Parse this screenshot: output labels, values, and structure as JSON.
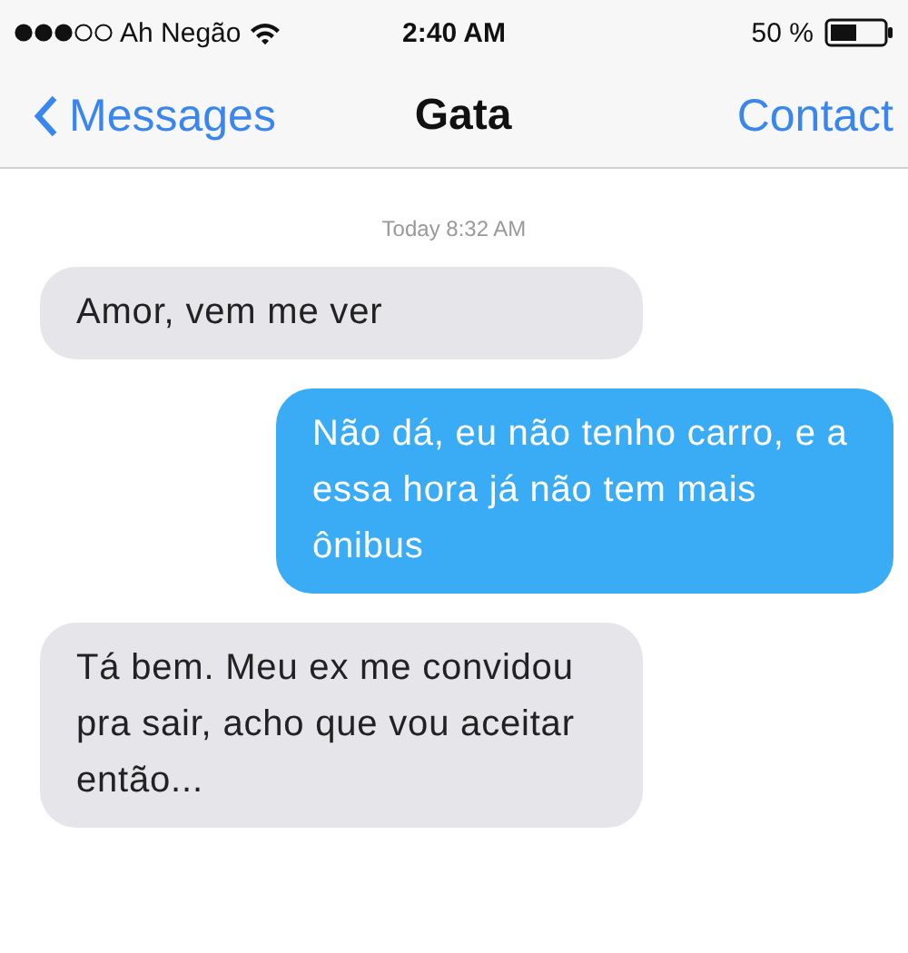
{
  "status_bar": {
    "carrier": "Ah Negão",
    "time": "2:40 AM",
    "battery": "50 %"
  },
  "nav_bar": {
    "back": "Messages",
    "title": "Gata",
    "action": "Contact"
  },
  "timestamp": "Today 8:32 AM",
  "messages": [
    {
      "kind": "received",
      "text": "Amor, vem me ver"
    },
    {
      "kind": "sent",
      "text": "Não dá, eu não tenho carro, e a essa hora já não tem mais ônibus"
    },
    {
      "kind": "received",
      "text": "Tá bem. Meu ex me convidou pra sair, acho que vou aceitar então..."
    }
  ]
}
